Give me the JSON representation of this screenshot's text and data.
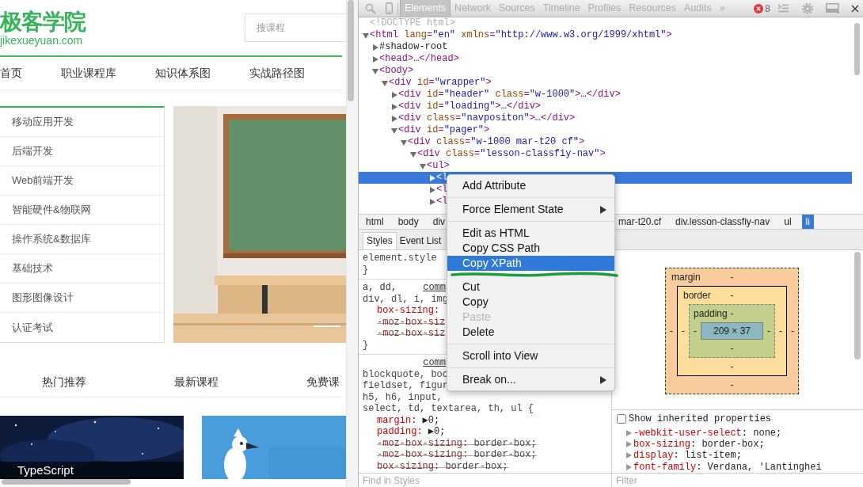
{
  "site": {
    "logo": {
      "title": "极客学院",
      "domain": "jikexueyuan.com"
    },
    "search": {
      "placeholder": "搜课程"
    },
    "nav": [
      "首页",
      "职业课程库",
      "知识体系图",
      "实战路径图"
    ],
    "categories": [
      "移动应用开发",
      "后端开发",
      "Web前端开发",
      "智能硬件&物联网",
      "操作系统&数据库",
      "基础技术",
      "图形图像设计",
      "认证考试"
    ],
    "banner": {
      "kind": "picture"
    },
    "course_tabs": [
      "热门推荐",
      "最新课程",
      "免费课"
    ],
    "courses": [
      {
        "kind": "space",
        "caption": "TypeScript"
      },
      {
        "kind": "bird"
      }
    ]
  },
  "devtools": {
    "toolbar": {
      "tabs": [
        {
          "label": "Elements",
          "selected": true
        },
        {
          "label": "Network",
          "selected": false
        },
        {
          "label": "Sources",
          "selected": false
        },
        {
          "label": "Timeline",
          "selected": false
        },
        {
          "label": "Profiles",
          "selected": false
        },
        {
          "label": "Resources",
          "selected": false
        },
        {
          "label": "Audits",
          "selected": false
        }
      ],
      "more": "»",
      "error_count": "8"
    },
    "dom": [
      {
        "kind": "doctype",
        "text": "<!DOCTYPE html>",
        "selected": false
      },
      {
        "kind": "node",
        "text": "<html lang=\"en\" xmlns=\"http://www.w3.org/1999/xhtml\">",
        "expanded": true,
        "selected": false,
        "children": [
          {
            "kind": "shadow",
            "text": "#shadow-root",
            "expanded": false,
            "selected": false
          },
          {
            "kind": "node",
            "text": "<head>…</head>",
            "expanded": false,
            "selected": false
          },
          {
            "kind": "node",
            "text": "<body>",
            "expanded": true,
            "selected": false,
            "children": [
              {
                "kind": "node",
                "text": "<div id=\"wrapper\">",
                "expanded": true,
                "selected": false,
                "children": [
                  {
                    "kind": "node",
                    "text": "<div id=\"header\" class=\"w-1000\">…</div>",
                    "expanded": false,
                    "selected": false
                  },
                  {
                    "kind": "node",
                    "text": "<div id=\"loading\">…</div>",
                    "expanded": false,
                    "selected": false
                  },
                  {
                    "kind": "node",
                    "text": "<div class=\"navpositon\">…</div>",
                    "expanded": false,
                    "selected": false
                  },
                  {
                    "kind": "node",
                    "text": "<div id=\"pager\">",
                    "expanded": true,
                    "selected": false,
                    "children": [
                      {
                        "kind": "node",
                        "text": "<div class=\"w-1000 mar-t20 cf\">",
                        "expanded": true,
                        "selected": false,
                        "children": [
                          {
                            "kind": "node",
                            "text": "<div class=\"lesson-classfiy-nav\">",
                            "expanded": true,
                            "selected": false,
                            "children": [
                              {
                                "kind": "node",
                                "text": "<ul>",
                                "expanded": true,
                                "selected": false,
                                "children": [
                                  {
                                    "kind": "node",
                                    "text": "<l",
                                    "expanded": false,
                                    "selected": true
                                  },
                                  {
                                    "kind": "node",
                                    "text": "<l",
                                    "expanded": false,
                                    "selected": false
                                  },
                                  {
                                    "kind": "node",
                                    "text": "<l",
                                    "expanded": false,
                                    "selected": false
                                  }
                                ]
                              }
                            ]
                          }
                        ]
                      }
                    ]
                  }
                ]
              }
            ]
          }
        ]
      }
    ],
    "breadcrumbs": [
      {
        "label": "html",
        "selected": false
      },
      {
        "label": "body",
        "selected": false
      },
      {
        "label": "div",
        "selected": false
      },
      {
        "label": "mar-t20.cf",
        "selected": false
      },
      {
        "label": "div.lesson-classfiy-nav",
        "selected": false
      },
      {
        "label": "ul",
        "selected": false
      },
      {
        "label": "li",
        "selected": true
      }
    ],
    "style_tabs": [
      {
        "label": "Styles",
        "selected": true
      },
      {
        "label": "Event List",
        "selected": false
      }
    ],
    "rules": [
      {
        "lines": [
          {
            "kind": "selector",
            "text": "element.style"
          },
          {
            "kind": "close",
            "text": "}"
          }
        ]
      },
      {
        "lines": [
          {
            "kind": "selector",
            "text": "a, dd,",
            "source": "comm"
          },
          {
            "kind": "selector",
            "text": "div, dl, i, img"
          },
          {
            "kind": "prop",
            "name": "box-sizing:",
            "overridden": false
          },
          {
            "kind": "prop",
            "name": "-moz-box-siz",
            "overridden": true
          },
          {
            "kind": "prop",
            "name": "-moz-box-siz",
            "overridden": true
          },
          {
            "kind": "close",
            "text": "}"
          }
        ]
      },
      {
        "lines": [
          {
            "kind": "source",
            "text": "comm"
          },
          {
            "kind": "selector",
            "text": "blockquote, boc"
          },
          {
            "kind": "selector",
            "text": "fieldset, figur"
          },
          {
            "kind": "selector",
            "text": "h5, h6, input,"
          },
          {
            "kind": "selector",
            "text": "select, td, textarea, th, ul {"
          },
          {
            "kind": "prop",
            "name": "margin:",
            "value": "▶0;",
            "overridden": false
          },
          {
            "kind": "prop",
            "name": "padding:",
            "value": "▶0;",
            "overridden": false
          },
          {
            "kind": "prop",
            "name": "-moz-box-sizing:",
            "value": "border-box;",
            "overridden": true
          },
          {
            "kind": "prop",
            "name": "-moz-box-sizing:",
            "value": "border-box;",
            "overridden": true
          },
          {
            "kind": "prop",
            "name": "box-sizing:",
            "value": "border-box;",
            "overridden": true
          }
        ]
      }
    ],
    "find_placeholder": "Find in Styles",
    "box_model": {
      "layers": [
        {
          "kind": "margin",
          "label": "margin",
          "top": "-"
        },
        {
          "kind": "border",
          "label": "border",
          "top": "-"
        },
        {
          "kind": "padding",
          "label": "padding",
          "top": "-"
        }
      ],
      "left_values": [
        "-",
        "-",
        "-"
      ],
      "content": "209 × 37",
      "right_values": [
        "-",
        "-",
        "-"
      ],
      "bottom_values": [
        "-",
        "-",
        "-"
      ]
    },
    "show_inherited": {
      "label": "Show inherited properties",
      "checked": false
    },
    "computed": [
      {
        "name": "-webkit-user-select",
        "value": ": none;"
      },
      {
        "name": "box-sizing",
        "value": ": border-box;"
      },
      {
        "name": "display",
        "value": ": list-item;"
      },
      {
        "name": "font-family",
        "value": ": Verdana, 'Lantinghei"
      }
    ],
    "filter_placeholder": "Filter"
  },
  "context_menu": {
    "groups": [
      [
        {
          "label": "Add Attribute",
          "submenu": false,
          "selected": false,
          "disabled": false
        }
      ],
      [
        {
          "label": "Force Element State",
          "submenu": true,
          "selected": false,
          "disabled": false
        }
      ],
      [
        {
          "label": "Edit as HTML",
          "submenu": false,
          "selected": false,
          "disabled": false
        },
        {
          "label": "Copy CSS Path",
          "submenu": false,
          "selected": false,
          "disabled": false
        },
        {
          "label": "Copy XPath",
          "submenu": false,
          "selected": true,
          "disabled": false
        }
      ],
      [
        {
          "label": "Cut",
          "submenu": false,
          "selected": false,
          "disabled": false
        },
        {
          "label": "Copy",
          "submenu": false,
          "selected": false,
          "disabled": false
        },
        {
          "label": "Paste",
          "submenu": false,
          "selected": false,
          "disabled": true
        },
        {
          "label": "Delete",
          "submenu": false,
          "selected": false,
          "disabled": false
        }
      ],
      [
        {
          "label": "Scroll into View",
          "submenu": false,
          "selected": false,
          "disabled": false
        }
      ],
      [
        {
          "label": "Break on...",
          "submenu": true,
          "selected": false,
          "disabled": false
        }
      ]
    ]
  }
}
